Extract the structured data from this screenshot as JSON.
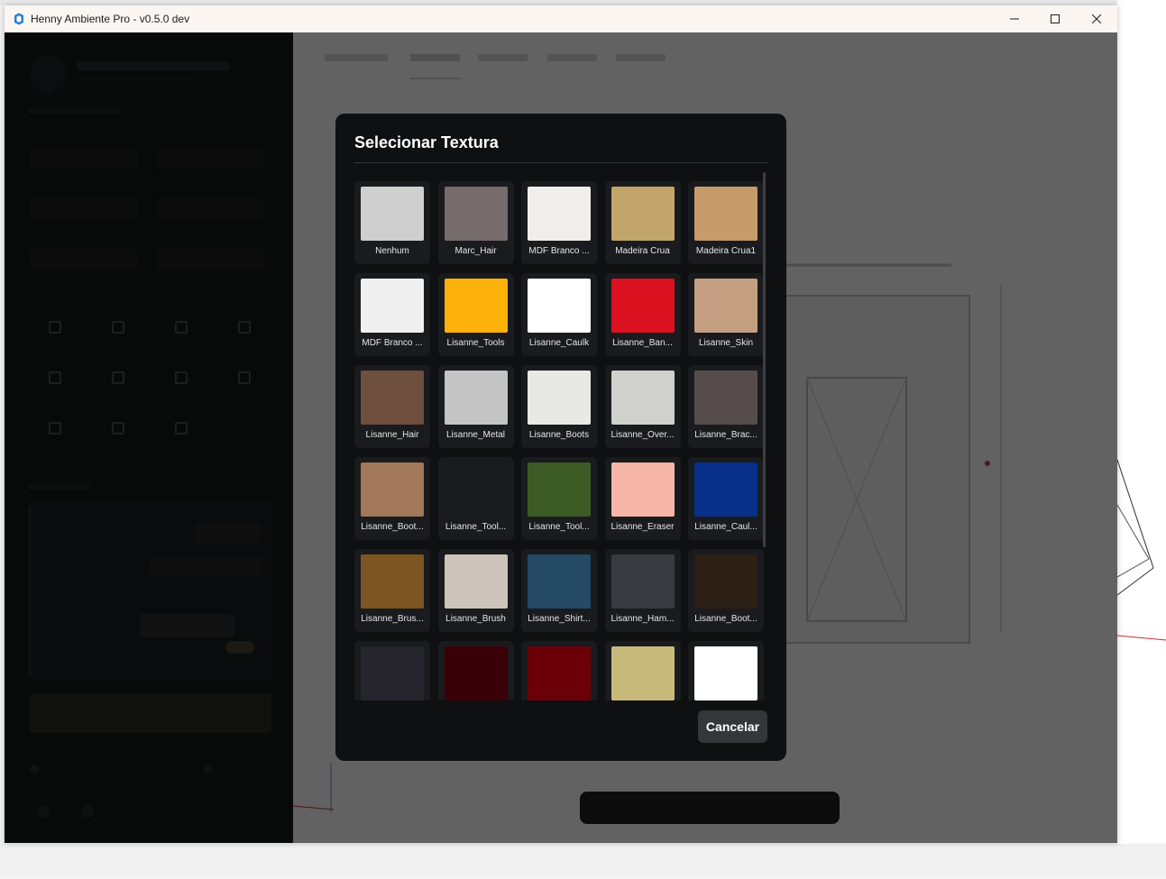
{
  "window": {
    "title": "Henny Ambiente Pro - v0.5.0 dev",
    "icon": "sketchup-icon",
    "controls": [
      "minimize-icon",
      "maximize-icon",
      "close-icon"
    ]
  },
  "modal": {
    "title": "Selecionar Textura",
    "cancel_label": "Cancelar",
    "textures": [
      {
        "label": "Nenhum",
        "color": "#cfcfcf"
      },
      {
        "label": "Marc_Hair",
        "color": "#766c6c"
      },
      {
        "label": "MDF Branco ...",
        "color": "#f0eeea"
      },
      {
        "label": "Madeira Crua",
        "color": "#c2a56a"
      },
      {
        "label": "Madeira Crua1",
        "color": "#c79a6a"
      },
      {
        "label": "MDF Branco ...",
        "color": "#efefef"
      },
      {
        "label": "Lisanne_Tools",
        "color": "#fdb20b"
      },
      {
        "label": "Lisanne_Caulk",
        "color": "#ffffff"
      },
      {
        "label": "Lisanne_Ban...",
        "color": "#dc1221"
      },
      {
        "label": "Lisanne_Skin",
        "color": "#c49f82"
      },
      {
        "label": "Lisanne_Hair",
        "color": "#6e4e3d"
      },
      {
        "label": "Lisanne_Metal",
        "color": "#c4c4c4"
      },
      {
        "label": "Lisanne_Boots",
        "color": "#e8e8e4"
      },
      {
        "label": "Lisanne_Over...",
        "color": "#d0d0cc"
      },
      {
        "label": "Lisanne_Brac...",
        "color": "#574c4c"
      },
      {
        "label": "Lisanne_Boot...",
        "color": "#a17859"
      },
      {
        "label": "Lisanne_Tool...",
        "color": "#1a1b1e"
      },
      {
        "label": "Lisanne_Tool...",
        "color": "#3b5a24"
      },
      {
        "label": "Lisanne_Eraser",
        "color": "#f6b6a8"
      },
      {
        "label": "Lisanne_Caul...",
        "color": "#08308a"
      },
      {
        "label": "Lisanne_Brus...",
        "color": "#7d5522"
      },
      {
        "label": "Lisanne_Brush",
        "color": "#ccc3ba"
      },
      {
        "label": "Lisanne_Shirt...",
        "color": "#244a66"
      },
      {
        "label": "Lisanne_Ham...",
        "color": "#393a3f"
      },
      {
        "label": "Lisanne_Boot...",
        "color": "#2c1f16"
      },
      {
        "label": "",
        "color": "#26252e"
      },
      {
        "label": "",
        "color": "#3a0008"
      },
      {
        "label": "",
        "color": "#6b0008"
      },
      {
        "label": "",
        "color": "#c7b97a"
      },
      {
        "label": "",
        "color": "#ffffff"
      }
    ]
  }
}
